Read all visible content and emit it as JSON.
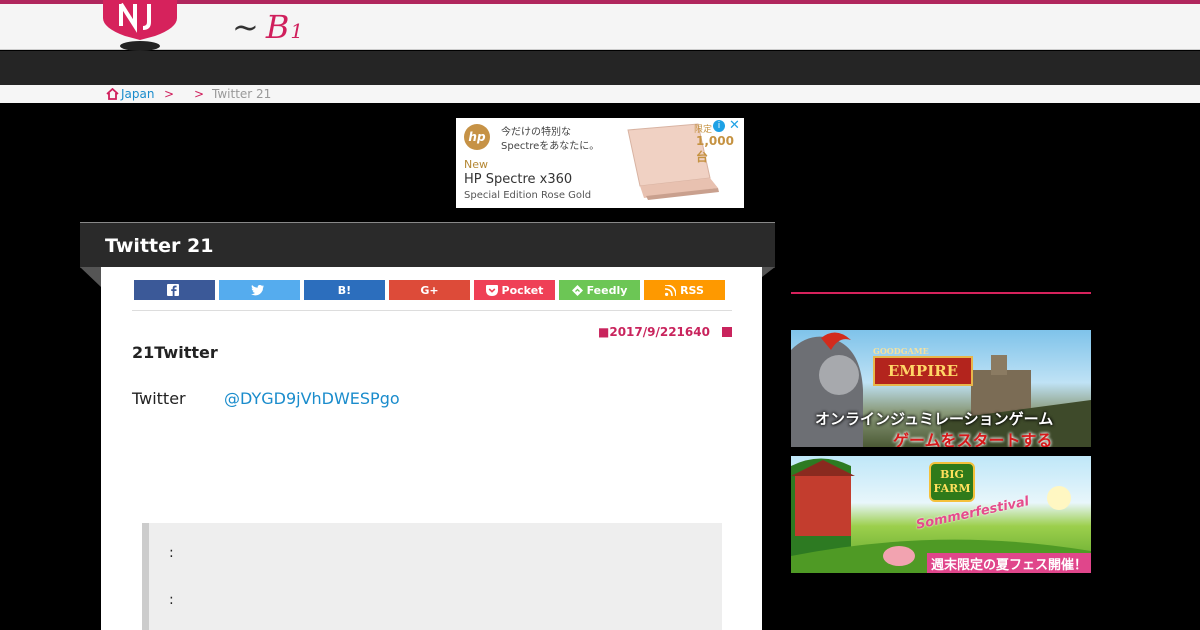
{
  "header": {
    "logo_tilde": "~",
    "logo_text": "B",
    "logo_sub": "1"
  },
  "breadcrumb": {
    "home_label": "Japan",
    "sep1": ">",
    "sep2": ">",
    "current": "Twitter 21"
  },
  "top_ad": {
    "brand": "hp",
    "copy": "今だけの特別な\nSpectreをあなたに。",
    "new_label": "New",
    "model": "HP Spectre x360",
    "edition": "Special Edition Rose Gold",
    "limit_label": "限定",
    "limit_count": "1,000台",
    "info": "i",
    "close": "✕"
  },
  "article": {
    "title": "Twitter 21",
    "share_buttons": [
      {
        "label": "",
        "icon": "facebook-icon",
        "color": "#3b5998"
      },
      {
        "label": "",
        "icon": "twitter-icon",
        "color": "#55acee"
      },
      {
        "label": "B!",
        "icon": "hatena-icon",
        "color": "#2c6ebd"
      },
      {
        "label": "G+",
        "icon": "googleplus-icon",
        "color": "#dd4b39"
      },
      {
        "label": "Pocket",
        "icon": "pocket-icon",
        "color": "#ef4056"
      },
      {
        "label": "Feedly",
        "icon": "feedly-icon",
        "color": "#6cc655"
      },
      {
        "label": "RSS",
        "icon": "rss-icon",
        "color": "#fe9900"
      }
    ],
    "date": "■2017/9/221640",
    "heading": "21Twitter",
    "line_label": "Twitter",
    "handle": "@DYGD9jVhDWESPgo",
    "quote_lines": [
      ":",
      ":"
    ]
  },
  "sidebar": {
    "banner1": {
      "brand_top": "GOODGAME",
      "brand": "EMPIRE",
      "text1": "オンラインジュミレーションゲーム",
      "text2": "ゲームをスタートする"
    },
    "banner2": {
      "brand": "BIG FARM",
      "sub": "Sommerfestival",
      "text": "週末限定の夏フェス開催！"
    }
  },
  "colors": {
    "accent": "#d01f5c",
    "link": "#1a8ccc",
    "title_bar": "#2a2a2a"
  }
}
